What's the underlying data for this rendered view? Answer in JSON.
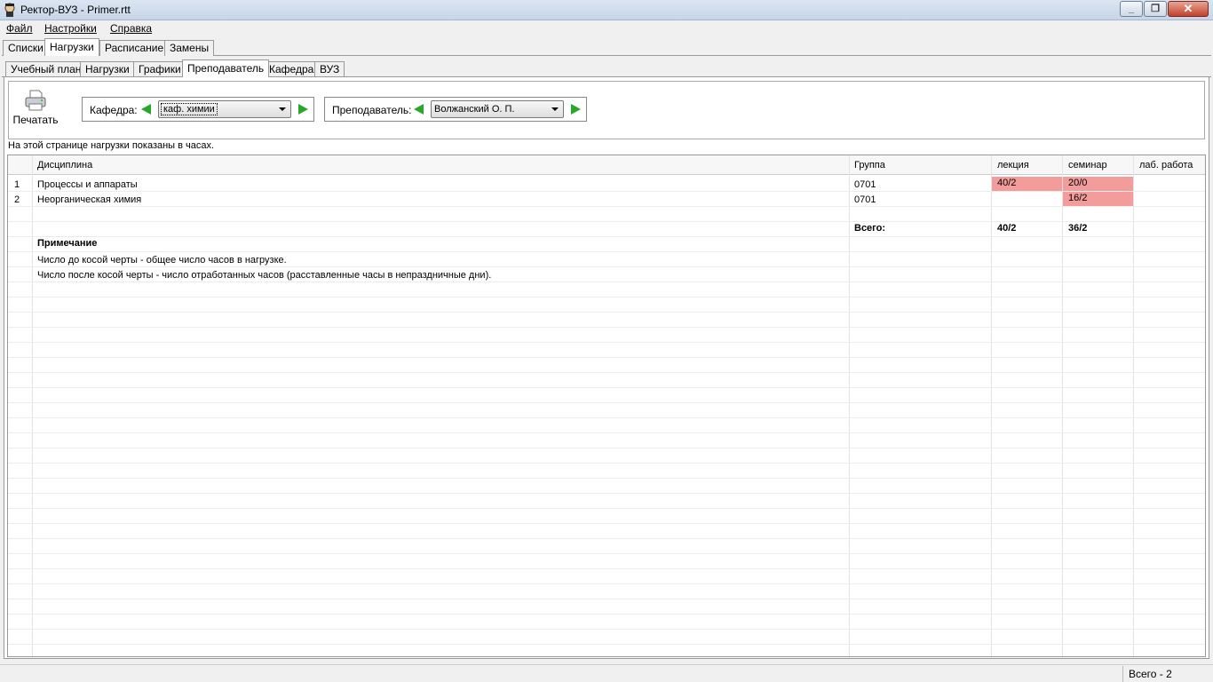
{
  "window": {
    "title": "Ректор-ВУЗ - Primer.rtt",
    "icon": "app-icon"
  },
  "menu": {
    "file": "Файл",
    "settings": "Настройки",
    "help": "Справка"
  },
  "main_tabs": [
    "Списки",
    "Нагрузки",
    "Расписание",
    "Замены"
  ],
  "sub_tabs": [
    "Учебный план",
    "Нагрузки",
    "Графики",
    "Преподаватель",
    "Кафедра",
    "ВУЗ"
  ],
  "toolbar": {
    "print_label": "Печатать",
    "department_label": "Кафедра:",
    "department_value": "каф. химии",
    "teacher_label": "Преподаватель:",
    "teacher_value": "Волжанский О. П."
  },
  "notice": "На этой странице нагрузки показаны в часах.",
  "table": {
    "headers": [
      "Дисциплина",
      "Группа",
      "лекция",
      "семинар",
      "лаб. работа"
    ],
    "rows": [
      {
        "n": "1",
        "discipline": "Процессы и аппараты",
        "group": "0701",
        "lecture": "40/2",
        "seminar": "20/0",
        "lab": ""
      },
      {
        "n": "2",
        "discipline": "Неорганическая химия",
        "group": "0701",
        "lecture": "",
        "seminar": "16/2",
        "lab": ""
      }
    ],
    "total_label": "Всего:",
    "total_lecture": "40/2",
    "total_seminar": "36/2",
    "note_title": "Примечание",
    "note_1": "Число до косой черты - общее число часов в нагрузке.",
    "note_2": "Число после косой черты - число отработанных часов (расставленные часы в непраздничные дни).",
    "highlight_color": "#f29c9c"
  },
  "status": {
    "total": "Всего - 2"
  }
}
